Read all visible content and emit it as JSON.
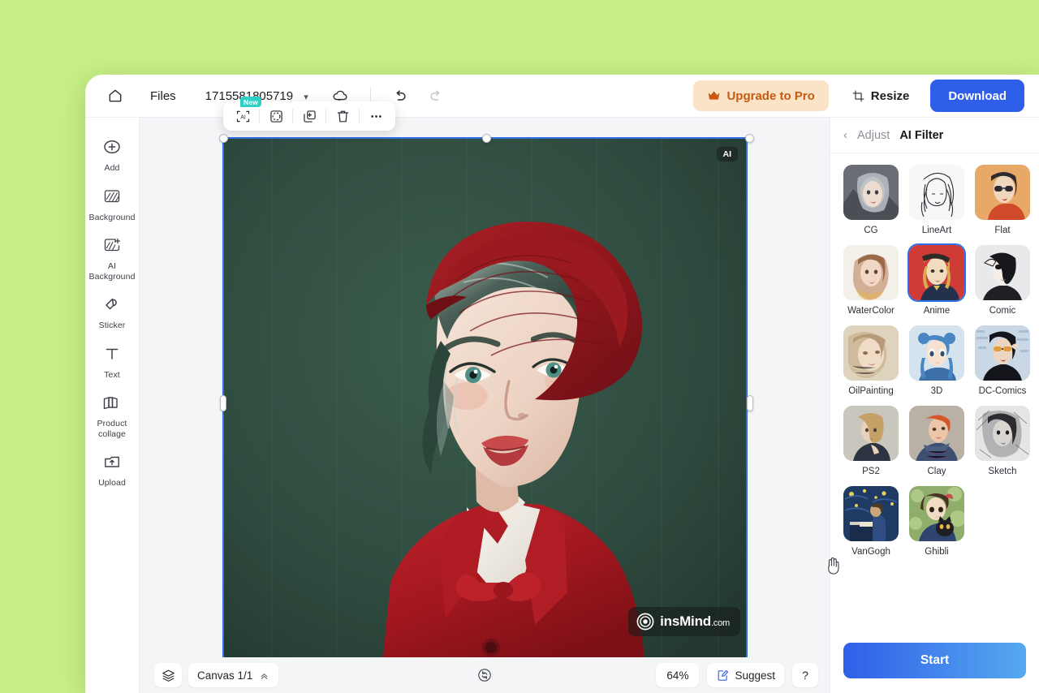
{
  "topbar": {
    "home_icon": "home-icon",
    "files_label": "Files",
    "doc_title": "1715581805719",
    "dropdown_icon": "chevron-down-icon",
    "cloud_icon": "cloud-save-icon",
    "undo_icon": "undo-icon",
    "redo_icon": "redo-icon",
    "upgrade_label": "Upgrade to Pro",
    "upgrade_icon": "crown-icon",
    "resize_label": "Resize",
    "resize_icon": "resize-icon",
    "download_label": "Download",
    "accent_blue": "#2f5fe8",
    "upgrade_bg": "#fbe3c8",
    "upgrade_fg": "#c55a10"
  },
  "sidebar": {
    "items": [
      {
        "label": "Add",
        "icon": "plus-circle-icon"
      },
      {
        "label": "Background",
        "icon": "background-icon"
      },
      {
        "label": "AI\nBackground",
        "icon": "ai-background-icon"
      },
      {
        "label": "Sticker",
        "icon": "sticker-icon"
      },
      {
        "label": "Text",
        "icon": "text-icon"
      },
      {
        "label": "Product\ncollage",
        "icon": "product-collage-icon"
      },
      {
        "label": "Upload",
        "icon": "upload-icon"
      }
    ]
  },
  "canvas": {
    "ai_tag": "AI",
    "watermark_main": "insMind",
    "watermark_suffix": ".com",
    "watermark_icon": "insmind-logo-icon",
    "selection_color": "#2f6fe8",
    "artboard_bg": "#2f4b3f",
    "element_toolbar": [
      {
        "name": "ai-tool",
        "icon": "ai-frame-icon",
        "badge": "New"
      },
      {
        "name": "crop-tool",
        "icon": "circle-crop-icon",
        "badge": ""
      },
      {
        "name": "duplicate-tool",
        "icon": "duplicate-icon",
        "badge": ""
      },
      {
        "name": "delete-tool",
        "icon": "trash-icon",
        "badge": ""
      },
      {
        "name": "more-tool",
        "icon": "ellipsis-icon",
        "badge": ""
      }
    ]
  },
  "bottombar": {
    "layers_icon": "layers-icon",
    "canvas_label": "Canvas 1/1",
    "canvas_expand_icon": "chevron-up-double-icon",
    "sync_icon": "sync-icon",
    "zoom_label": "64%",
    "suggest_label": "Suggest",
    "suggest_icon": "suggest-icon",
    "help_label": "?"
  },
  "right_panel": {
    "back_icon": "chevron-left-icon",
    "breadcrumb": "Adjust",
    "title": "AI Filter",
    "start_label": "Start",
    "selected_filter": "Anime",
    "filters": [
      {
        "label": "CG",
        "style": "cg"
      },
      {
        "label": "LineArt",
        "style": "lineart"
      },
      {
        "label": "Flat",
        "style": "flat"
      },
      {
        "label": "WaterColor",
        "style": "watercolor"
      },
      {
        "label": "Anime",
        "style": "anime"
      },
      {
        "label": "Comic",
        "style": "comic"
      },
      {
        "label": "OilPainting",
        "style": "oilpainting"
      },
      {
        "label": "3D",
        "style": "threed"
      },
      {
        "label": "DC-Comics",
        "style": "dccomics"
      },
      {
        "label": "PS2",
        "style": "ps2"
      },
      {
        "label": "Clay",
        "style": "clay"
      },
      {
        "label": "Sketch",
        "style": "sketch"
      },
      {
        "label": "VanGogh",
        "style": "vangogh"
      },
      {
        "label": "Ghibli",
        "style": "ghibli"
      }
    ]
  },
  "page": {
    "background_color": "#c6ef85"
  }
}
